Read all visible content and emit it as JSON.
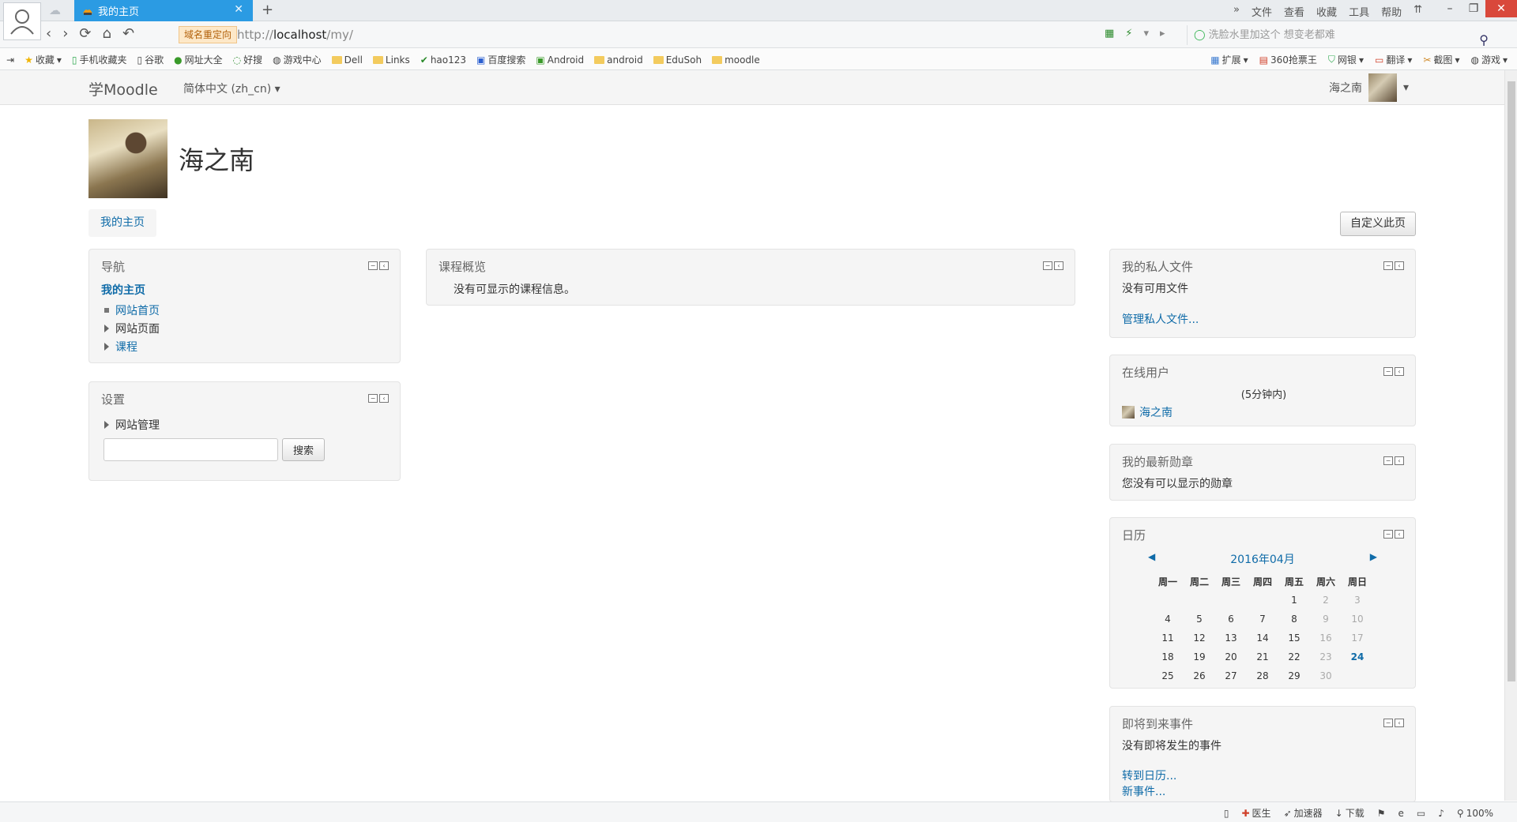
{
  "browser": {
    "tab_title": "我的主页",
    "new_tab": "+",
    "menu": [
      "»",
      "文件",
      "查看",
      "收藏",
      "工具",
      "帮助"
    ],
    "redirect_badge": "域名重定向",
    "url_scheme": "http://",
    "url_host": "localhost",
    "url_path": "/my/",
    "search_placeholder": "洗脸水里加这个 想变老都难",
    "bookmarks": [
      "收藏",
      "手机收藏夹",
      "谷歌",
      "网址大全",
      "好搜",
      "游戏中心",
      "Dell",
      "Links",
      "hao123",
      "百度搜索",
      "Android",
      "android",
      "EduSoh",
      "moodle"
    ],
    "bookmarks_right": [
      "扩展",
      "360抢票王",
      "网银",
      "翻译",
      "截图",
      "游戏"
    ],
    "status": [
      "医生",
      "加速器",
      "下载",
      "100%"
    ]
  },
  "moodle": {
    "brand": "学Moodle",
    "language": "简体中文 (zh_cn)",
    "username": "海之南",
    "page_title": "海之南",
    "breadcrumb": "我的主页",
    "customize_button": "自定义此页"
  },
  "blocks": {
    "navigation": {
      "title": "导航",
      "home": "我的主页",
      "items": [
        "网站首页",
        "网站页面",
        "课程"
      ]
    },
    "settings": {
      "title": "设置",
      "item": "网站管理",
      "search_button": "搜索"
    },
    "course_overview": {
      "title": "课程概览",
      "text": "没有可显示的课程信息。"
    },
    "private_files": {
      "title": "我的私人文件",
      "text": "没有可用文件",
      "link": "管理私人文件..."
    },
    "online_users": {
      "title": "在线用户",
      "period": "(5分钟内)",
      "user": "海之南"
    },
    "badges": {
      "title": "我的最新勋章",
      "text": "您没有可以显示的勋章"
    },
    "calendar": {
      "title": "日历",
      "month": "2016年04月",
      "weekdays": [
        "周一",
        "周二",
        "周三",
        "周四",
        "周五",
        "周六",
        "周日"
      ],
      "weeks": [
        [
          "",
          "",
          "",
          "",
          "1",
          "2",
          "3"
        ],
        [
          "4",
          "5",
          "6",
          "7",
          "8",
          "9",
          "10"
        ],
        [
          "11",
          "12",
          "13",
          "14",
          "15",
          "16",
          "17"
        ],
        [
          "18",
          "19",
          "20",
          "21",
          "22",
          "23",
          "24"
        ],
        [
          "25",
          "26",
          "27",
          "28",
          "29",
          "30",
          ""
        ]
      ],
      "today": "24"
    },
    "upcoming": {
      "title": "即将到来事件",
      "text": "没有即将发生的事件",
      "link_calendar": "转到日历...",
      "link_new": "新事件..."
    }
  }
}
